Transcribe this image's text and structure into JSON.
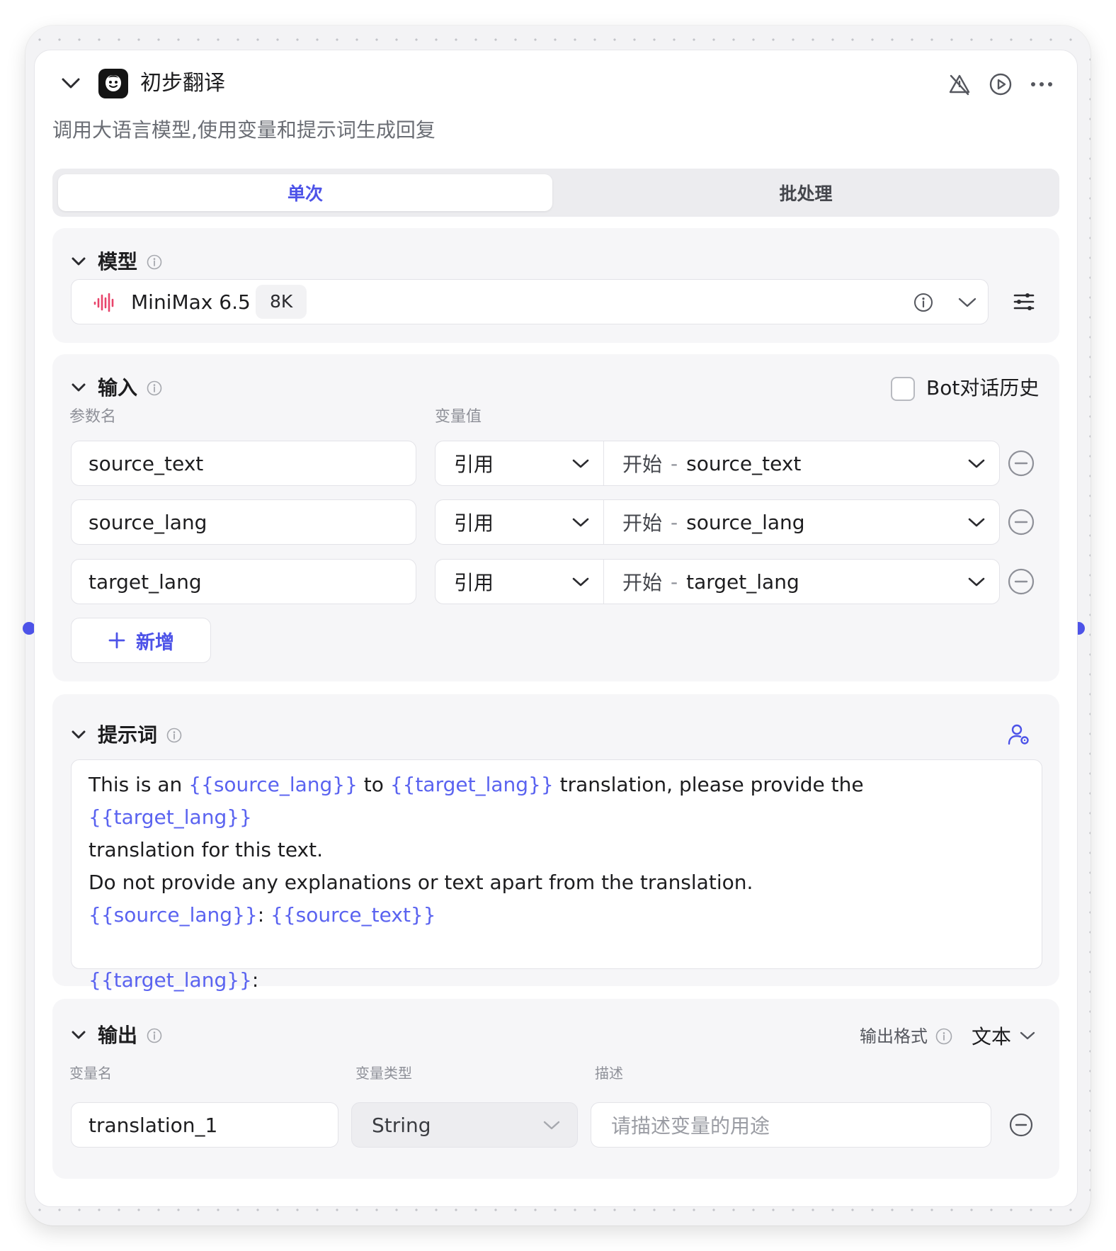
{
  "node": {
    "title": "初步翻译",
    "description": "调用大语言模型,使用变量和提示词生成回复",
    "header_icons": [
      "warning-off-icon",
      "play-circle-icon",
      "more-horizontal-icon"
    ]
  },
  "tabs": {
    "single": "单次",
    "batch": "批处理",
    "active": "单次"
  },
  "model": {
    "section_label": "模型",
    "name": "MiniMax 6.5",
    "context": "8K",
    "brand_color": "#e8446a"
  },
  "input": {
    "section_label": "输入",
    "history_label": "Bot对话历史",
    "history_checked": false,
    "col_name": "参数名",
    "col_value": "变量值",
    "rows": [
      {
        "name": "source_text",
        "type": "引用",
        "source": "开始",
        "sep": "-",
        "ref": "source_text"
      },
      {
        "name": "source_lang",
        "type": "引用",
        "source": "开始",
        "sep": "-",
        "ref": "source_lang"
      },
      {
        "name": "target_lang",
        "type": "引用",
        "source": "开始",
        "sep": "-",
        "ref": "target_lang"
      }
    ],
    "add_label": "新增"
  },
  "prompt": {
    "section_label": "提示词",
    "line1": {
      "a": "This is an ",
      "v1": "{{source_lang}}",
      "b": " to ",
      "v2": "{{target_lang}}",
      "c": " translation, please provide the ",
      "v3": "{{target_lang}}"
    },
    "line2": "translation for this text.",
    "line3": "Do not provide any explanations or text apart from the translation.",
    "line4": {
      "v1": "{{source_lang}}",
      "a": ": ",
      "v2": "{{source_text}}"
    },
    "line6": {
      "v1": "{{target_lang}}",
      "a": ":"
    }
  },
  "output": {
    "section_label": "输出",
    "format_label": "输出格式",
    "format_value": "文本",
    "col_name": "变量名",
    "col_type": "变量类型",
    "col_desc": "描述",
    "row": {
      "name": "translation_1",
      "type": "String",
      "desc_placeholder": "请描述变量的用途"
    }
  },
  "colors": {
    "accent": "#4d53e8",
    "variable": "#5a63f0"
  }
}
